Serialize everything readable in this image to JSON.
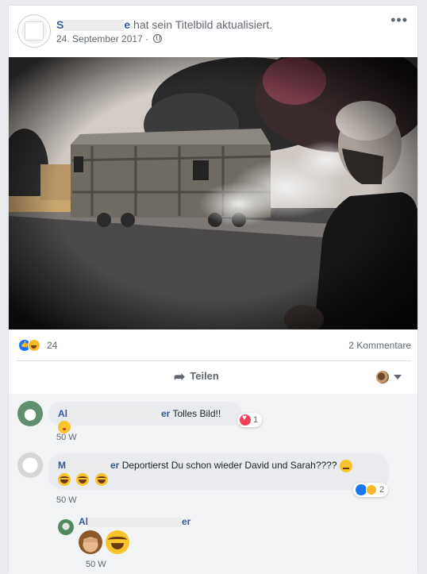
{
  "post": {
    "author_visible_start": "S",
    "author_visible_end": "e",
    "action_text": "hat sein Titelbild aktualisiert.",
    "date": "24. September 2017",
    "date_separator": "·",
    "more_label": "•••"
  },
  "stats": {
    "reaction_count": "24",
    "comment_count": "2 Kommentare"
  },
  "actions": {
    "share_label": "Teilen"
  },
  "comments": [
    {
      "name_start": "Al",
      "name_end": "er",
      "text": "Tolles Bild!!",
      "reaction_count": "1",
      "time": "50 W"
    },
    {
      "name_start": "M",
      "name_end": "er",
      "text": "Deportierst Du schon wieder David und Sarah????",
      "reaction_count": "2",
      "time": "50 W"
    }
  ],
  "reply": {
    "name_start": "Al",
    "name_end": "er",
    "time": "50 W"
  },
  "icons": {
    "globe": "globe-icon",
    "share": "share-icon",
    "caret": "chevron-down-icon",
    "like": "like-icon",
    "haha": "haha-icon",
    "love": "love-icon"
  },
  "colors": {
    "link": "#385898",
    "like_blue": "#1877f2",
    "love_red": "#f33e58",
    "haha_yellow": "#f7b928",
    "comment_bg": "#f2f3f5"
  }
}
